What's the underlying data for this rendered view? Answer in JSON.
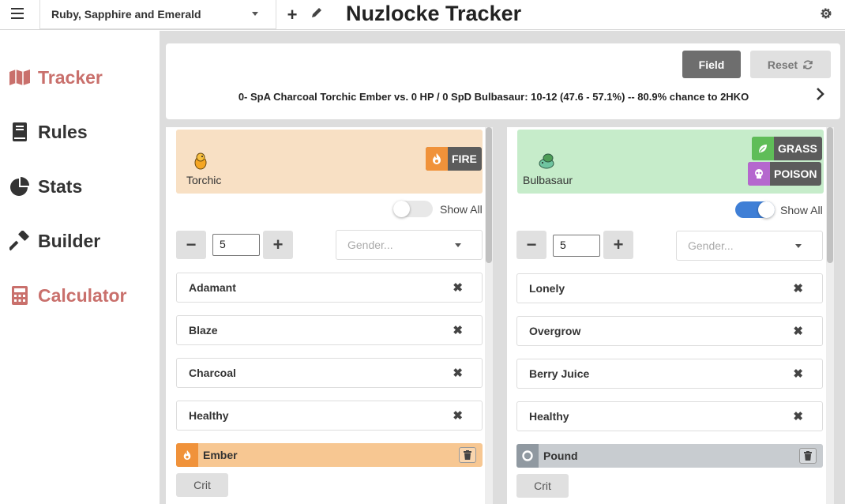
{
  "header": {
    "game_select": "Ruby, Sapphire and Emerald",
    "title": "Nuzlocke Tracker"
  },
  "sidebar": {
    "items": [
      {
        "label": "Tracker",
        "icon": "map-icon",
        "active": true
      },
      {
        "label": "Rules",
        "icon": "book-icon",
        "active": false
      },
      {
        "label": "Stats",
        "icon": "pie-chart-icon",
        "active": false
      },
      {
        "label": "Builder",
        "icon": "hammer-icon",
        "active": false
      },
      {
        "label": "Calculator",
        "icon": "calculator-icon",
        "active": true
      }
    ]
  },
  "calculator": {
    "field_label": "Field",
    "reset_label": "Reset",
    "result": "0- SpA Charcoal Torchic Ember vs. 0 HP / 0 SpD Bulbasaur: 10-12 (47.6 - 57.1%) -- 80.9% chance to 2HKO"
  },
  "left": {
    "pokemon": "Torchic",
    "types": [
      "FIRE"
    ],
    "show_all_label": "Show All",
    "show_all": false,
    "level": "5",
    "gender_placeholder": "Gender...",
    "nature": "Adamant",
    "ability": "Blaze",
    "item": "Charcoal",
    "status": "Healthy",
    "move": "Ember",
    "crit_label": "Crit"
  },
  "right": {
    "pokemon": "Bulbasaur",
    "types": [
      "GRASS",
      "POISON"
    ],
    "show_all_label": "Show All",
    "show_all": true,
    "level": "5",
    "gender_placeholder": "Gender...",
    "nature": "Lonely",
    "ability": "Overgrow",
    "item": "Berry Juice",
    "status": "Healthy",
    "move": "Pound",
    "crit_label": "Crit"
  },
  "colors": {
    "accent": "#c9706c",
    "fire": "#f0923a",
    "grass": "#5fbd58",
    "poison": "#b567ce",
    "normal": "#9099a1",
    "toggle_on": "#3f7fd6"
  }
}
